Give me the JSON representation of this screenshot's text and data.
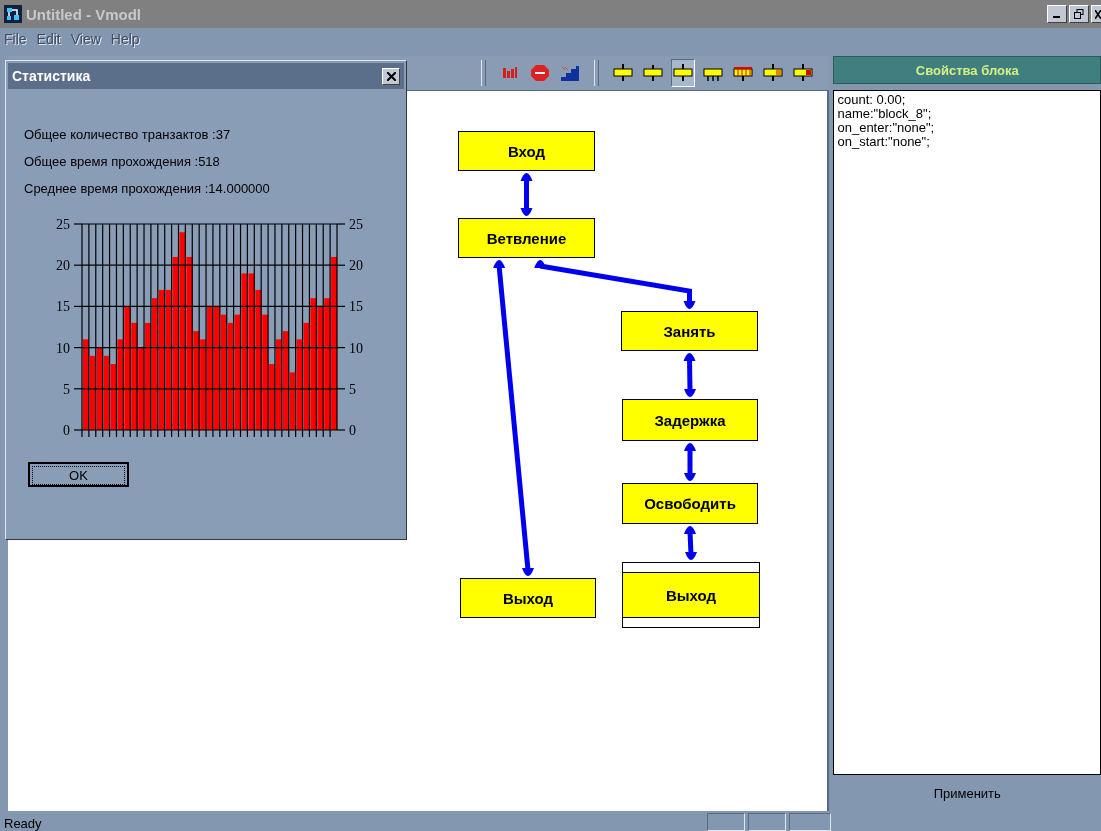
{
  "window": {
    "title": "Untitled - Vmodl"
  },
  "menu": [
    {
      "label": "File",
      "disabled": true
    },
    {
      "label": "Edit",
      "disabled": true
    },
    {
      "label": "View",
      "disabled": true
    },
    {
      "label": "Help",
      "disabled": true
    }
  ],
  "toolbar": [
    {
      "kind": "go",
      "selected": false
    },
    {
      "kind": "stop",
      "selected": false
    },
    {
      "kind": "chart",
      "selected": false
    },
    {
      "kind": "enter",
      "selected": false
    },
    {
      "kind": "plain",
      "selected": false
    },
    {
      "kind": "generate",
      "selected": true
    },
    {
      "kind": "split",
      "selected": false
    },
    {
      "kind": "table",
      "selected": false
    },
    {
      "kind": "seize",
      "selected": false
    },
    {
      "kind": "release",
      "selected": false
    }
  ],
  "diagram": {
    "blocks": [
      {
        "label": "Вход",
        "selected": false
      },
      {
        "label": "Ветвление",
        "selected": false
      },
      {
        "label": "Занять",
        "selected": false
      },
      {
        "label": "Задержка",
        "selected": false
      },
      {
        "label": "Освободить",
        "selected": false
      },
      {
        "label": "Выход",
        "selected": false
      },
      {
        "label": "Выход",
        "selected": true
      }
    ]
  },
  "properties_panel": {
    "title": "Свойства блока",
    "lines": [
      "count: 0.00;",
      "name:\"block_8\";",
      "on_enter:\"none\";",
      "on_start:\"none\";"
    ],
    "apply_button": "Применить"
  },
  "statistics_dialog": {
    "title": "Статистика",
    "lines": [
      "Общее количество транзактов :37",
      "Общее время прохождения :518",
      "Среднее время прохождения :14.000000"
    ],
    "chart_data": {
      "type": "bar",
      "grid": true,
      "series": [
        {
          "color": "#ff0000",
          "values": [
            11,
            9,
            10,
            9,
            8,
            11,
            15,
            13,
            10,
            13,
            16,
            17,
            17,
            21,
            24,
            21,
            12,
            11,
            15,
            15,
            14,
            13,
            14,
            19,
            19,
            17,
            14,
            8,
            11,
            12,
            7,
            11,
            13,
            16,
            15,
            16,
            21
          ]
        }
      ],
      "ylim": [
        0,
        25
      ],
      "yticks": [
        {
          "value": 0,
          "label": "0"
        },
        {
          "value": 5,
          "label": "5"
        },
        {
          "value": 10,
          "label": "10"
        },
        {
          "value": 15,
          "label": "15"
        },
        {
          "value": 20,
          "label": "20"
        },
        {
          "value": 25,
          "label": "25"
        }
      ]
    },
    "ok_button": "OK"
  },
  "status_bar": {
    "text": "Ready"
  }
}
